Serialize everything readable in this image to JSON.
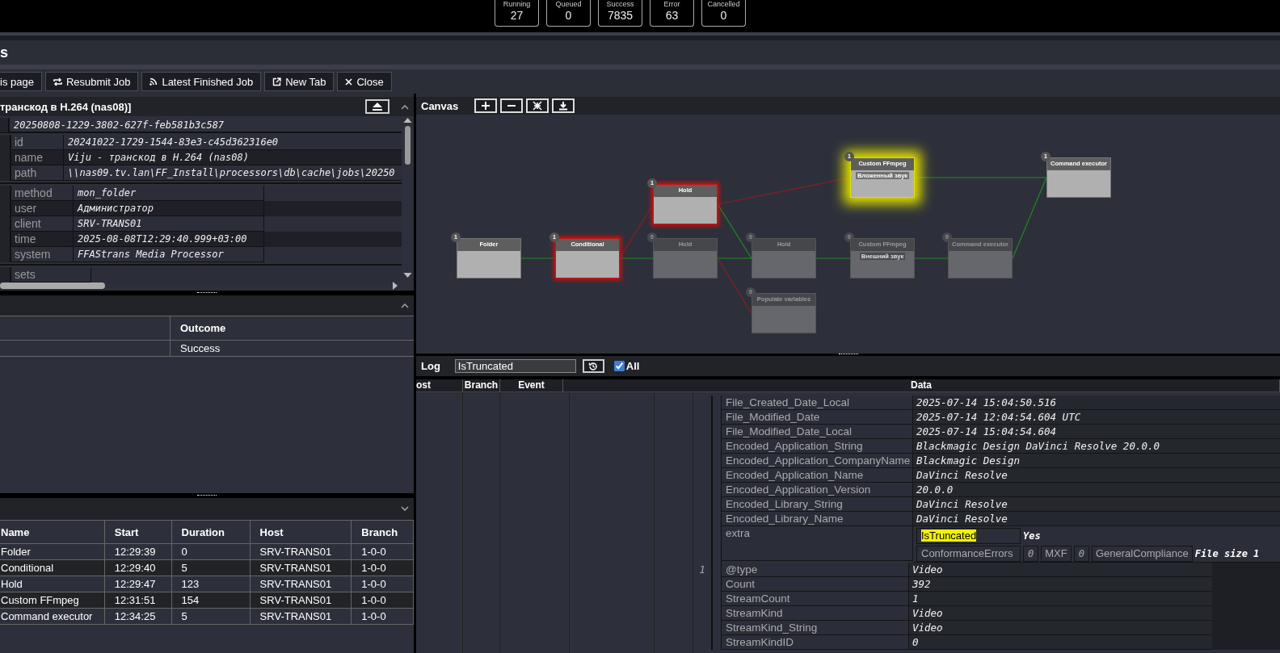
{
  "status_counters": [
    {
      "label": "Running",
      "value": "27"
    },
    {
      "label": "Queued",
      "value": "0"
    },
    {
      "label": "Success",
      "value": "7835"
    },
    {
      "label": "Error",
      "value": "63"
    },
    {
      "label": "Cancelled",
      "value": "0"
    }
  ],
  "page_title": "s",
  "toolbar": [
    "is page",
    "Resubmit Job",
    "Latest Finished Job",
    "New Tab",
    "Close"
  ],
  "job_panel": {
    "title": "транскод в H.264 (nas08)]",
    "root_value": "20250808-1229-3802-627f-feb581b3c587",
    "groups": [
      {
        "rows": [
          {
            "key": "id",
            "value": "20241022-1729-1544-83e3-c45d362316e0"
          },
          {
            "key": "name",
            "value": "Viju - транскод в H.264 (nas08)"
          },
          {
            "key": "path",
            "value": "\\\\nas09.tv.lan\\FF_Install\\processors\\db\\cache\\jobs\\20250"
          }
        ]
      },
      {
        "rows": [
          {
            "key": "method",
            "value": "mon_folder"
          },
          {
            "key": "user",
            "value": "Администратор"
          },
          {
            "key": "client",
            "value": "SRV-TRANS01"
          },
          {
            "key": "time",
            "value": "2025-08-08T12:29:40.999+03:00"
          },
          {
            "key": "system",
            "value": "FFAStrans Media Processor"
          }
        ]
      }
    ],
    "sets_key": "sets"
  },
  "outcome_panel": {
    "column": "Outcome",
    "rows": [
      {
        "outcome": "Success"
      }
    ]
  },
  "nodes_panel": {
    "columns": [
      "Name",
      "Start",
      "Duration",
      "Host",
      "Branch"
    ],
    "rows": [
      [
        "Folder",
        "12:29:39",
        "0",
        "SRV-TRANS01",
        "1-0-0"
      ],
      [
        "Conditional",
        "12:29:40",
        "5",
        "SRV-TRANS01",
        "1-0-0"
      ],
      [
        "Hold",
        "12:29:47",
        "123",
        "SRV-TRANS01",
        "1-0-0"
      ],
      [
        "Custom FFmpeg",
        "12:31:51",
        "154",
        "SRV-TRANS01",
        "1-0-0"
      ],
      [
        "Command executor",
        "12:34:25",
        "5",
        "SRV-TRANS01",
        "1-0-0"
      ]
    ]
  },
  "canvas": {
    "title": "Canvas",
    "nodes": [
      {
        "name": "Custom FFmpeg",
        "count": "1",
        "active": true,
        "color": "#e0e000",
        "subtitle": "Вложенный звук"
      },
      {
        "name": "Command executor",
        "count": "1",
        "active": true
      },
      {
        "name": "Hold",
        "count": "1",
        "active": true,
        "color": "#d01010"
      },
      {
        "name": "Folder",
        "count": "1",
        "active": true
      },
      {
        "name": "Conditional",
        "count": "1",
        "active": true,
        "color": "#d01010"
      },
      {
        "name": "Hold",
        "count": "0",
        "active": false
      },
      {
        "name": "Hold",
        "count": "0",
        "active": false
      },
      {
        "name": "Custom FFmpeg",
        "count": "0",
        "active": false,
        "subtitle": "Внешний звук"
      },
      {
        "name": "Command executor",
        "count": "0",
        "active": false
      },
      {
        "name": "Populate variables",
        "count": "0",
        "active": false
      }
    ],
    "edges": [
      {
        "kind": "success"
      },
      {
        "kind": "error"
      },
      {
        "kind": "success"
      },
      {
        "kind": "error"
      },
      {
        "kind": "success"
      },
      {
        "kind": "success"
      },
      {
        "kind": "error"
      },
      {
        "kind": "success"
      },
      {
        "kind": "success"
      },
      {
        "kind": "success"
      },
      {
        "kind": "success"
      }
    ]
  },
  "log": {
    "title": "Log",
    "filter": "IsTruncated",
    "all": {
      "label": "All",
      "checked": true
    },
    "columns": [
      "ost",
      "Branch",
      "Event",
      "Data"
    ],
    "blocks": [
      {
        "rows": [
          {
            "key": "File_Created_Date_Local",
            "value": "2025-07-14 15:04:50.516"
          },
          {
            "key": "File_Modified_Date",
            "value": "2025-07-14 12:04:54.604 UTC"
          },
          {
            "key": "File_Modified_Date_Local",
            "value": "2025-07-14 15:04:54.604"
          },
          {
            "key": "Encoded_Application_String",
            "value": "Blackmagic Design DaVinci Resolve 20.0.0"
          },
          {
            "key": "Encoded_Application_CompanyName",
            "value": "Blackmagic Design"
          },
          {
            "key": "Encoded_Application_Name",
            "value": "DaVinci Resolve"
          },
          {
            "key": "Encoded_Application_Version",
            "value": "20.0.0"
          },
          {
            "key": "Encoded_Library_String",
            "value": "DaVinci Resolve"
          },
          {
            "key": "Encoded_Library_Name",
            "value": "DaVinci Resolve"
          }
        ],
        "extra": {
          "key": "extra",
          "rows": [
            {
              "key": "IsTruncated",
              "highlighted": true,
              "cells": [
                {
                  "kind": "value",
                  "text": "Yes"
                }
              ]
            },
            {
              "key": "ConformanceErrors",
              "highlighted": false,
              "cells": [
                {
                  "kind": "index",
                  "text": "0"
                },
                {
                  "kind": "key",
                  "text": "MXF"
                },
                {
                  "kind": "index",
                  "text": "0"
                },
                {
                  "kind": "key",
                  "text": "GeneralCompliance"
                },
                {
                  "kind": "value",
                  "text": "File size 1"
                }
              ]
            }
          ]
        }
      },
      {
        "index": "1",
        "rows": [
          {
            "key": "@type",
            "value": "Video"
          },
          {
            "key": "Count",
            "value": "392"
          },
          {
            "key": "StreamCount",
            "value": "1"
          },
          {
            "key": "StreamKind",
            "value": "Video"
          },
          {
            "key": "StreamKind_String",
            "value": "Video"
          },
          {
            "key": "StreamKindID",
            "value": "0"
          }
        ]
      }
    ]
  }
}
